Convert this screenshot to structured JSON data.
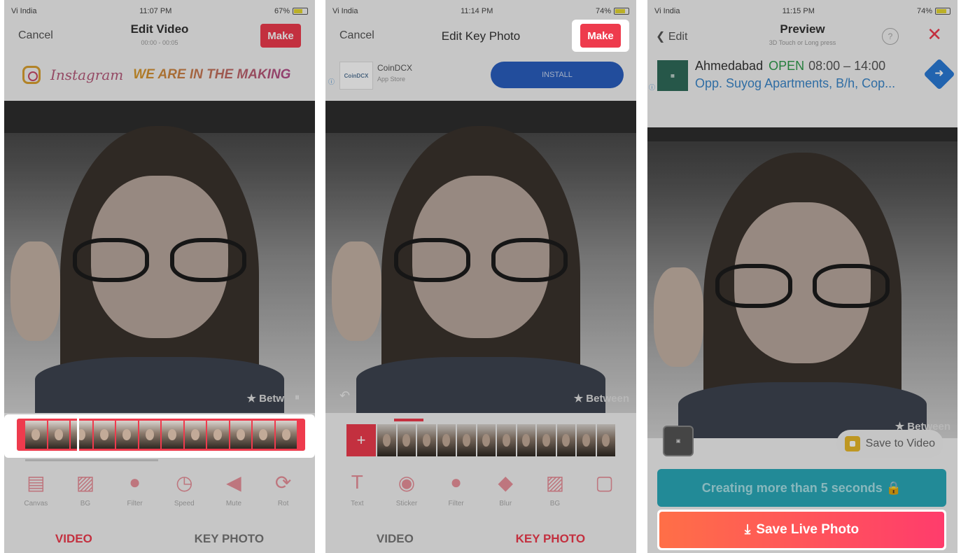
{
  "panel1": {
    "status": {
      "carrier": "Vi India",
      "time": "11:07 PM",
      "battery": "67%"
    },
    "nav": {
      "cancel": "Cancel",
      "title": "Edit Video",
      "subtitle": "00:00 - 00:05",
      "make": "Make"
    },
    "ad": {
      "brand": "Instagram",
      "tagline": "WE ARE IN THE MAKING"
    },
    "watermark": "★ Betw",
    "tools": [
      {
        "label": "Canvas",
        "icon": "canvas-icon"
      },
      {
        "label": "BG",
        "icon": "background-icon"
      },
      {
        "label": "Filter",
        "icon": "filter-icon"
      },
      {
        "label": "Speed",
        "icon": "speed-icon"
      },
      {
        "label": "Mute",
        "icon": "mute-icon"
      },
      {
        "label": "Rot",
        "icon": "rotate-icon"
      }
    ],
    "tabs": {
      "video": "VIDEO",
      "key_photo": "KEY PHOTO",
      "active": "video"
    }
  },
  "panel2": {
    "status": {
      "carrier": "Vi India",
      "time": "11:14 PM",
      "battery": "74%"
    },
    "nav": {
      "cancel": "Cancel",
      "title": "Edit Key Photo",
      "make": "Make"
    },
    "ad": {
      "name": "CoinDCX",
      "sub": "App Store",
      "install": "INSTALL"
    },
    "watermark": "★ Between",
    "plus": "+",
    "tools": [
      {
        "label": "Text",
        "icon": "text-icon"
      },
      {
        "label": "Sticker",
        "icon": "sticker-icon"
      },
      {
        "label": "Filter",
        "icon": "filter-icon"
      },
      {
        "label": "Blur",
        "icon": "blur-icon"
      },
      {
        "label": "BG",
        "icon": "background-icon"
      },
      {
        "label": "",
        "icon": "more-icon"
      }
    ],
    "tabs": {
      "video": "VIDEO",
      "key_photo": "KEY PHOTO",
      "active": "key_photo"
    }
  },
  "panel3": {
    "status": {
      "carrier": "Vi India",
      "time": "11:15 PM",
      "battery": "74%"
    },
    "nav": {
      "back": "Edit",
      "title": "Preview",
      "subtitle": "3D Touch or Long press"
    },
    "ad": {
      "city": "Ahmedabad",
      "open": "OPEN",
      "hours": "08:00 – 14:00",
      "address": "Opp. Suyog Apartments, B/h, Cop..."
    },
    "watermark": "★ Between",
    "save_to_video": "Save to Video",
    "creating": "Creating more than 5 seconds 🔒",
    "save_live_photo": "Save Live Photo"
  },
  "colors": {
    "accent": "#ee3b4d",
    "teal": "#2aa9b9",
    "install": "#2a5fbf"
  }
}
